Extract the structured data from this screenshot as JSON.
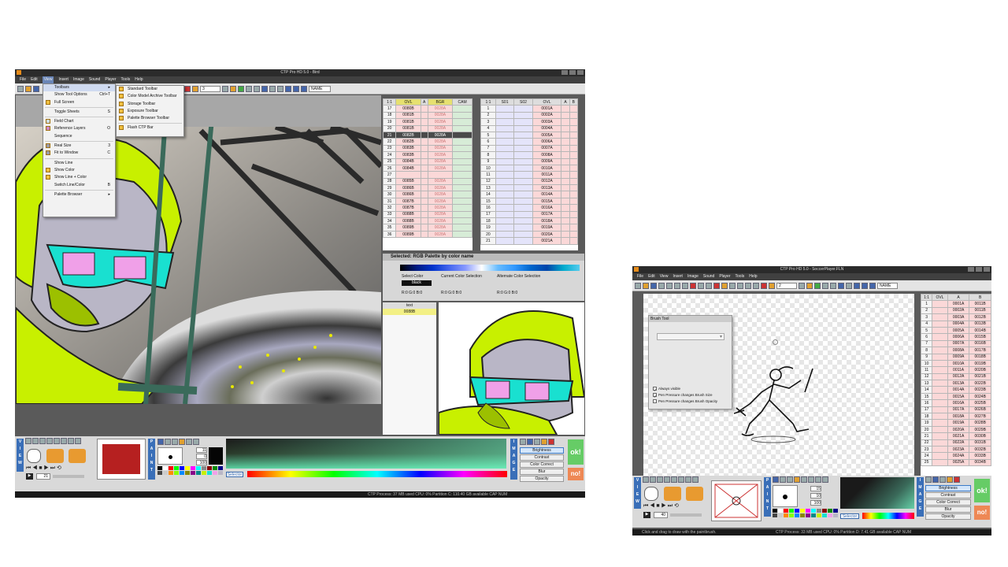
{
  "left": {
    "title": "CTP Pro HD 5.0 - Bird",
    "menu": [
      "File",
      "Edit",
      "View",
      "Insert",
      "Image",
      "Sound",
      "Player",
      "Tools",
      "Help"
    ],
    "toolbar_frame": "3",
    "toolbar_name": "NAME",
    "view_menu": {
      "items": [
        {
          "label": "Toolbars",
          "shortcut": ""
        },
        {
          "label": "Show Tool Options",
          "shortcut": "Ctrl+T"
        },
        {
          "label": "Full Screen",
          "shortcut": ""
        },
        {
          "label": "Toggle Sheets",
          "shortcut": "S"
        },
        {
          "label": "Field Chart",
          "shortcut": ""
        },
        {
          "label": "Reference Layers",
          "shortcut": "O"
        },
        {
          "label": "Sequence",
          "shortcut": ""
        },
        {
          "label": "Real Size",
          "shortcut": "3"
        },
        {
          "label": "Fit to Window",
          "shortcut": "C"
        },
        {
          "label": "Show Line",
          "shortcut": ""
        },
        {
          "label": "Show Color",
          "shortcut": ""
        },
        {
          "label": "Show Line + Color",
          "shortcut": ""
        },
        {
          "label": "Switch Line/Color",
          "shortcut": "B"
        },
        {
          "label": "Palette Browser",
          "shortcut": ""
        }
      ]
    },
    "toolbars_submenu": [
      "Standard Toolbar",
      "Color Model Archive Toolbar",
      "Storage Toolbar",
      "Exposure Toolbar",
      "Palette Browser Toolbar",
      "Flash CTP Bar"
    ],
    "xsheet_a": {
      "headers": [
        "1:1",
        "OVL",
        "A",
        "BGR",
        "CAM"
      ],
      "rows": [
        [
          "17",
          "0080B",
          "",
          "0028A"
        ],
        [
          "18",
          "0081B",
          "",
          "0028A"
        ],
        [
          "19",
          "0081B",
          "",
          "0028A"
        ],
        [
          "20",
          "0081B",
          "",
          "0028A"
        ],
        [
          "21",
          "0082B",
          "",
          "0028A"
        ],
        [
          "22",
          "0082B",
          "",
          "0028A"
        ],
        [
          "23",
          "0083B",
          "",
          "0028A"
        ],
        [
          "24",
          "0083B",
          "",
          "0028A"
        ],
        [
          "25",
          "0084B",
          "",
          "0028A"
        ],
        [
          "26",
          "0084B",
          "",
          "0028A"
        ],
        [
          "27",
          "",
          "",
          ""
        ],
        [
          "28",
          "0085B",
          "",
          "0028A"
        ],
        [
          "29",
          "0086B",
          "",
          "0028A"
        ],
        [
          "30",
          "0086B",
          "",
          "0028A"
        ],
        [
          "31",
          "0087B",
          "",
          "0028A"
        ],
        [
          "32",
          "0087B",
          "",
          "0028A"
        ],
        [
          "33",
          "0088B",
          "",
          "0028A"
        ],
        [
          "34",
          "0088B",
          "",
          "0028A"
        ],
        [
          "35",
          "0089B",
          "",
          "0028A"
        ],
        [
          "36",
          "0089B",
          "",
          "0028A"
        ]
      ]
    },
    "xsheet_b": {
      "headers": [
        "1:1",
        "S01",
        "S02",
        "OVL",
        "A",
        "B"
      ],
      "rows": [
        [
          "1",
          "0001A"
        ],
        [
          "2",
          "0002A"
        ],
        [
          "3",
          "0003A"
        ],
        [
          "4",
          "0004A"
        ],
        [
          "5",
          "0005A"
        ],
        [
          "6",
          "0006A"
        ],
        [
          "7",
          "0007A"
        ],
        [
          "8",
          "0008A"
        ],
        [
          "9",
          "0009A"
        ],
        [
          "10",
          "0010A"
        ],
        [
          "11",
          "0011A"
        ],
        [
          "12",
          "0012A"
        ],
        [
          "13",
          "0013A"
        ],
        [
          "14",
          "0014A"
        ],
        [
          "15",
          "0015A"
        ],
        [
          "16",
          "0016A"
        ],
        [
          "17",
          "0017A"
        ],
        [
          "18",
          "0018A"
        ],
        [
          "19",
          "0019A"
        ],
        [
          "20",
          "0020A"
        ],
        [
          "21",
          "0021A"
        ]
      ]
    },
    "palette": {
      "title": "Selected: RGB Palette by color name",
      "select_color": "Select Color",
      "color_name": "black",
      "current_color": "Current Color Selection",
      "alternate_color": "Alternate Color Selection",
      "rgb_current": "R:0  G:0  B:0",
      "rgb_alt": "R:0  G:0  B:0",
      "rgb_sel": "R:0  G:0  B:0"
    },
    "layer_list": {
      "header": "text",
      "item": "0088B"
    },
    "bottom": {
      "frame": "21",
      "brush_size": "11",
      "brush_min": "0",
      "brush_opacity": "100",
      "selector": "Selector",
      "image_buttons": [
        "Brightness",
        "Contrast",
        "Color Correct",
        "Blur",
        "Opacity"
      ],
      "ok": "ok!",
      "no": "no!"
    },
    "status": "CTP Process:  37 MB used   CPU:  0%   Partition C:  110.40 GB available   CAP  NUM"
  },
  "right": {
    "title": "CTP Pro HD 5.0 - SoccerPlayer.FLN",
    "menu": [
      "File",
      "Edit",
      "View",
      "Insert",
      "Image",
      "Sound",
      "Player",
      "Tools",
      "Help"
    ],
    "toolbar_frame": "2",
    "toolbar_name": "NAME",
    "brush_tool": {
      "title": "Brush Tool",
      "options": [
        "Always visible",
        "Pen Pressure changes Brush Size",
        "Pen Pressure changes Brush Opacity"
      ],
      "checked": [
        true,
        true,
        false
      ]
    },
    "xsheet": {
      "headers": [
        "1:1",
        "OVL",
        "A",
        "B"
      ],
      "rows": [
        [
          "1",
          "",
          "0001A",
          "0011B"
        ],
        [
          "2",
          "",
          "0002A",
          "0011B"
        ],
        [
          "3",
          "",
          "0003A",
          "0012B"
        ],
        [
          "4",
          "",
          "0004A",
          "0013B"
        ],
        [
          "5",
          "",
          "0005A",
          "0014B"
        ],
        [
          "6",
          "",
          "0006A",
          "0015B"
        ],
        [
          "7",
          "",
          "0007A",
          "0016B"
        ],
        [
          "8",
          "",
          "0008A",
          "0017B"
        ],
        [
          "9",
          "",
          "0009A",
          "0018B"
        ],
        [
          "10",
          "",
          "0010A",
          "0019B"
        ],
        [
          "11",
          "",
          "0011A",
          "0020B"
        ],
        [
          "12",
          "",
          "0012A",
          "0021B"
        ],
        [
          "13",
          "",
          "0013A",
          "0022B"
        ],
        [
          "14",
          "",
          "0014A",
          "0023B"
        ],
        [
          "15",
          "",
          "0015A",
          "0024B"
        ],
        [
          "16",
          "",
          "0016A",
          "0025B"
        ],
        [
          "17",
          "",
          "0017A",
          "0026B"
        ],
        [
          "18",
          "",
          "0018A",
          "0027B"
        ],
        [
          "19",
          "",
          "0019A",
          "0028B"
        ],
        [
          "20",
          "",
          "0020A",
          "0029B"
        ],
        [
          "21",
          "",
          "0021A",
          "0030B"
        ],
        [
          "22",
          "",
          "0022A",
          "0031B"
        ],
        [
          "23",
          "",
          "0023A",
          "0032B"
        ],
        [
          "24",
          "",
          "0024A",
          "0033B"
        ],
        [
          "25",
          "",
          "0025A",
          "0034B"
        ]
      ]
    },
    "bottom": {
      "frame": "40",
      "brush_size": "15",
      "brush_min": "10",
      "brush_opacity": "100",
      "selector": "Selector",
      "image_buttons": [
        "Brightness",
        "Contrast",
        "Color Correct",
        "Blur",
        "Opacity"
      ],
      "ok": "ok!",
      "no": "no!"
    },
    "status_hint": "Click and drag to draw with the paintbrush.",
    "status": "CTP Process:  33 MB used   CPU:  0%   Partition D:  7.41 GB available   CAP  NUM"
  },
  "colors": {
    "accent": "#3a6fb8",
    "lime": "#c8f000",
    "ok": "#66cc66",
    "no": "#ee8855"
  }
}
